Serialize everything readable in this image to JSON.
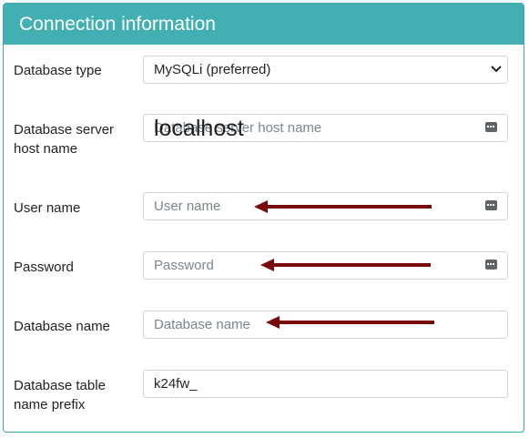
{
  "panel": {
    "title": "Connection information"
  },
  "fields": {
    "db_type": {
      "label": "Database type",
      "value": "MySQLi (preferred)"
    },
    "db_host": {
      "label": "Database server host name",
      "placeholder": "Database server host name",
      "annotation": "localhost"
    },
    "db_user": {
      "label": "User name",
      "placeholder": "User name"
    },
    "db_password": {
      "label": "Password",
      "placeholder": "Password"
    },
    "db_name": {
      "label": "Database name",
      "placeholder": "Database name"
    },
    "db_prefix": {
      "label": "Database table name prefix",
      "value": "k24fw_"
    }
  },
  "colors": {
    "header": "#42b0b3",
    "arrow": "#7a0a0a"
  },
  "icons": {
    "select": "chevron-down-icon",
    "autofill": "keyboard-icon"
  }
}
